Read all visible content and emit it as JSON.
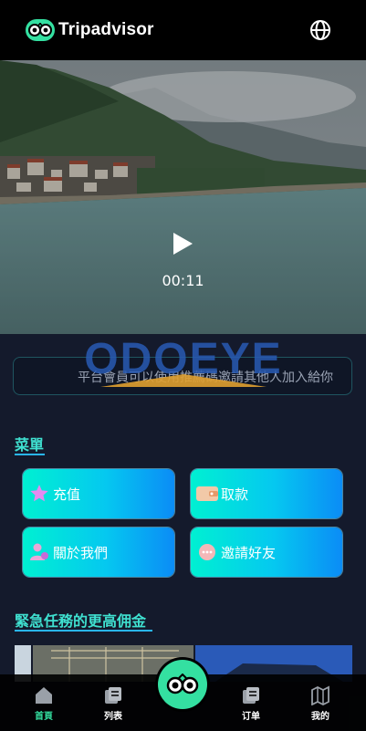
{
  "header": {
    "brand": "Tripadvisor",
    "owl_icon": "owl-logo-icon",
    "globe_icon": "globe-icon"
  },
  "video": {
    "time": "00:11",
    "play_icon": "play-icon"
  },
  "watermark": {
    "text": "ODOEYE"
  },
  "notice": {
    "text": "平台會員可以使用推薦碼邀請其他人加入給你"
  },
  "menu": {
    "title": "菜單",
    "items": [
      {
        "label": "充值",
        "icon": "star-icon"
      },
      {
        "label": "取款",
        "icon": "wallet-icon"
      },
      {
        "label": "關於我們",
        "icon": "person-icon"
      },
      {
        "label": "邀請好友",
        "icon": "chat-bubble-icon"
      }
    ]
  },
  "tasks": {
    "title": "緊急任務的更高佣金"
  },
  "bottom_nav": {
    "items": [
      {
        "label": "首頁",
        "icon": "home-icon",
        "active": true
      },
      {
        "label": "列表",
        "icon": "list-icon",
        "active": false
      },
      {
        "label": "订单",
        "icon": "orders-icon",
        "active": false
      },
      {
        "label": "我的",
        "icon": "map-icon",
        "active": false
      }
    ],
    "center_icon": "owl-logo-icon"
  },
  "colors": {
    "accent": "#34e0a1",
    "section_title": "#3fe0d0",
    "background": "#141a2c"
  }
}
